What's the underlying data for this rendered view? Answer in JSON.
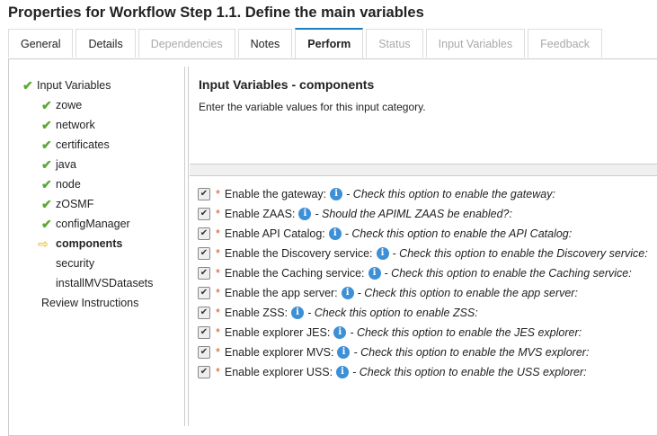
{
  "title": "Properties for Workflow Step 1.1. Define the main variables",
  "tabs": [
    {
      "label": "General",
      "state": "enabled"
    },
    {
      "label": "Details",
      "state": "enabled"
    },
    {
      "label": "Dependencies",
      "state": "disabled"
    },
    {
      "label": "Notes",
      "state": "enabled"
    },
    {
      "label": "Perform",
      "state": "active"
    },
    {
      "label": "Status",
      "state": "disabled"
    },
    {
      "label": "Input Variables",
      "state": "disabled"
    },
    {
      "label": "Feedback",
      "state": "disabled"
    }
  ],
  "nav": {
    "root": "Input Variables",
    "items": [
      {
        "label": "zowe",
        "status": "check"
      },
      {
        "label": "network",
        "status": "check"
      },
      {
        "label": "certificates",
        "status": "check"
      },
      {
        "label": "java",
        "status": "check"
      },
      {
        "label": "node",
        "status": "check"
      },
      {
        "label": "zOSMF",
        "status": "check"
      },
      {
        "label": "configManager",
        "status": "check"
      },
      {
        "label": "components",
        "status": "current"
      },
      {
        "label": "security",
        "status": "none"
      },
      {
        "label": "installMVSDatasets",
        "status": "none"
      }
    ],
    "review": "Review Instructions"
  },
  "main": {
    "heading": "Input Variables - components",
    "description": "Enter the variable values for this input category.",
    "fields": [
      {
        "label": "Enable the gateway:",
        "help": "- Check this option to enable the gateway:",
        "checked": true
      },
      {
        "label": "Enable ZAAS:",
        "help": "- Should the APIML ZAAS be enabled?:",
        "checked": true
      },
      {
        "label": "Enable API Catalog:",
        "help": "- Check this option to enable the API Catalog:",
        "checked": true
      },
      {
        "label": "Enable the Discovery service:",
        "help": "- Check this option to enable the Discovery service:",
        "checked": true
      },
      {
        "label": "Enable the Caching service:",
        "help": "- Check this option to enable the Caching service:",
        "checked": true
      },
      {
        "label": "Enable the app server:",
        "help": "- Check this option to enable the app server:",
        "checked": true
      },
      {
        "label": "Enable ZSS:",
        "help": "- Check this option to enable ZSS:",
        "checked": true
      },
      {
        "label": "Enable explorer JES:",
        "help": "- Check this option to enable the JES explorer:",
        "checked": true
      },
      {
        "label": "Enable explorer MVS:",
        "help": "- Check this option to enable the MVS explorer:",
        "checked": true
      },
      {
        "label": "Enable explorer USS:",
        "help": "- Check this option to enable the USS explorer:",
        "checked": true
      }
    ]
  }
}
